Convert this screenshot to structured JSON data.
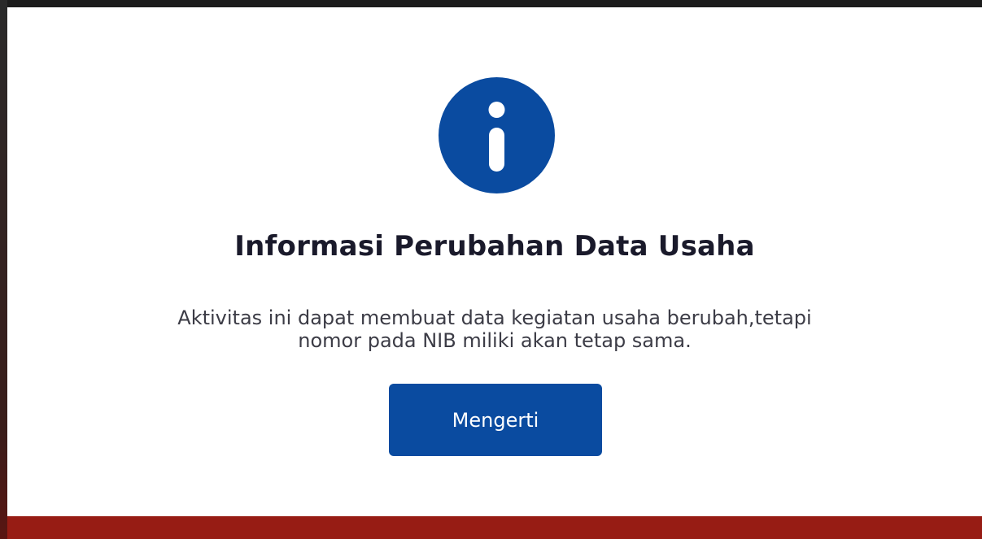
{
  "modal": {
    "icon": "info-icon",
    "title": "Informasi Perubahan Data Usaha",
    "message_line1": "Aktivitas ini dapat membuat data kegiatan usaha berubah,tetapi",
    "message_line2": "nomor pada NIB miliki akan tetap sama.",
    "button_label": "Mengerti"
  },
  "colors": {
    "accent": "#0a4ba0",
    "footer": "#971c14",
    "title_text": "#1a1a2b",
    "body_text": "#3c3c46"
  }
}
